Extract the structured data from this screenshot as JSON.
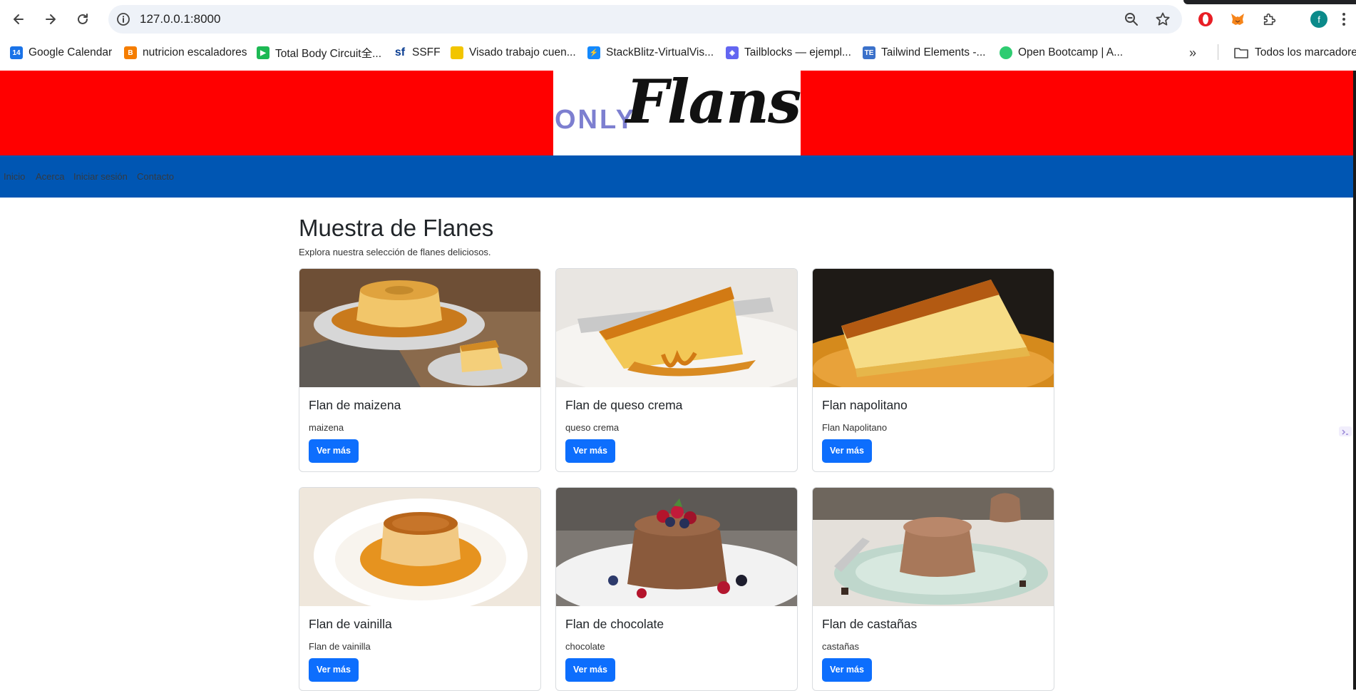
{
  "browser": {
    "url": "127.0.0.1:8000",
    "profile_initial": "f",
    "bookmarks": [
      {
        "label": "Google Calendar",
        "icon": "calendar-icon",
        "color": "#1a73e8"
      },
      {
        "label": "nutricion escaladores",
        "icon": "blogger-icon",
        "color": "#f57d00"
      },
      {
        "label": "Total Body Circuit全...",
        "icon": "video-icon",
        "color": "#1db954"
      },
      {
        "label": "SSFF",
        "icon": "sf-icon",
        "color": "#0a3d91"
      },
      {
        "label": "Visado trabajo cuen...",
        "icon": "doc-icon",
        "color": "#f2c500"
      },
      {
        "label": "StackBlitz-VirtualVis...",
        "icon": "stackblitz-icon",
        "color": "#1389fd"
      },
      {
        "label": "Tailblocks — ejempl...",
        "icon": "tailblocks-icon",
        "color": "#6366f1"
      },
      {
        "label": "Tailwind Elements -...",
        "icon": "te-icon",
        "color": "#3b71ca"
      },
      {
        "label": "Open Bootcamp | A...",
        "icon": "openbootcamp-icon",
        "color": "#2ecc71"
      }
    ],
    "bookmarks_folder": "Todos los marcadores"
  },
  "site": {
    "logo_only": "ONLY",
    "logo_flans": "Flans",
    "nav": [
      "Inicio",
      "Acerca",
      "Iniciar sesión",
      "Contacto"
    ],
    "colors": {
      "banner": "#ff0000",
      "navbar": "#0056b3",
      "button": "#0d6efd"
    }
  },
  "main": {
    "title": "Muestra de Flanes",
    "subtitle": "Explora nuestra selección de flanes deliciosos.",
    "button_label": "Ver más",
    "cards": [
      {
        "title": "Flan de maizena",
        "text": "maizena"
      },
      {
        "title": "Flan de queso crema",
        "text": "queso crema"
      },
      {
        "title": "Flan napolitano",
        "text": "Flan Napolitano"
      },
      {
        "title": "Flan de vainilla",
        "text": "Flan de vainilla"
      },
      {
        "title": "Flan de chocolate",
        "text": "chocolate"
      },
      {
        "title": "Flan de castañas",
        "text": "castañas"
      }
    ]
  }
}
